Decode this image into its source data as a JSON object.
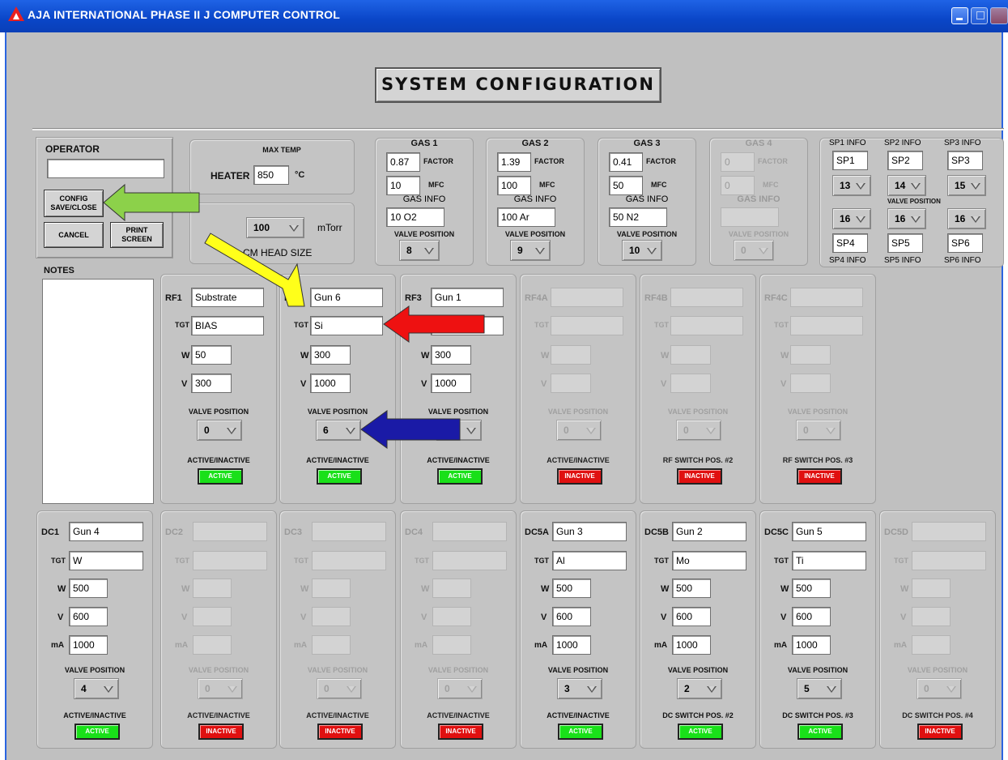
{
  "window": {
    "title": "AJA INTERNATIONAL PHASE II J COMPUTER CONTROL"
  },
  "header": {
    "title": "SYSTEM CONFIGURATION"
  },
  "operator": {
    "label": "OPERATOR",
    "value": "",
    "config_button": "CONFIG SAVE/CLOSE",
    "cancel_button": "CANCEL",
    "print_button": "PRINT SCREEN"
  },
  "notes": {
    "label": "NOTES",
    "value": ""
  },
  "heater": {
    "max_label": "MAX TEMP",
    "label": "HEATER",
    "value": "850",
    "unit": "°C"
  },
  "cm_head": {
    "value": "100",
    "unit": "mTorr",
    "label": "CM HEAD SIZE"
  },
  "gas": [
    {
      "name": "GAS 1",
      "factor": "0.87",
      "mfc": "10",
      "info": "10 O2",
      "valve": "8",
      "enabled": true
    },
    {
      "name": "GAS 2",
      "factor": "1.39",
      "mfc": "100",
      "info": "100 Ar",
      "valve": "9",
      "enabled": true
    },
    {
      "name": "GAS 3",
      "factor": "0.41",
      "mfc": "50",
      "info": "50 N2",
      "valve": "10",
      "enabled": true
    },
    {
      "name": "GAS 4",
      "factor": "0",
      "mfc": "0",
      "info": "",
      "valve": "0",
      "enabled": false
    }
  ],
  "gas_labels": {
    "factor": "FACTOR",
    "mfc": "MFC",
    "info": "GAS INFO",
    "valve": "VALVE POSITION"
  },
  "sp": {
    "top_labels": [
      "SP1 INFO",
      "SP2 INFO",
      "SP3 INFO"
    ],
    "top_values": [
      "SP1",
      "SP2",
      "SP3"
    ],
    "top_valves": [
      "13",
      "14",
      "15"
    ],
    "valve_label": "VALVE POSITION",
    "bottom_valves": [
      "16",
      "16",
      "16"
    ],
    "bottom_values": [
      "SP4",
      "SP5",
      "SP6"
    ],
    "bottom_labels": [
      "SP4 INFO",
      "SP5 INFO",
      "SP6 INFO"
    ]
  },
  "common": {
    "tgt": "TGT",
    "w": "W",
    "v": "V",
    "ma": "mA",
    "valve": "VALVE POSITION"
  },
  "rf": [
    {
      "name": "RF1",
      "gun": "Substrate",
      "tgt": "BIAS",
      "w": "50",
      "v": "300",
      "valve": "0",
      "status_label": "ACTIVE/INACTIVE",
      "status": "ACTIVE",
      "enabled": true
    },
    {
      "name": "RF2",
      "gun": "Gun 6",
      "tgt": "Si",
      "w": "300",
      "v": "1000",
      "valve": "6",
      "status_label": "ACTIVE/INACTIVE",
      "status": "ACTIVE",
      "enabled": true
    },
    {
      "name": "RF3",
      "gun": "Gun 1",
      "tgt": "",
      "w": "300",
      "v": "1000",
      "valve": "",
      "status_label": "ACTIVE/INACTIVE",
      "status": "ACTIVE",
      "enabled": true
    },
    {
      "name": "RF4A",
      "gun": "",
      "tgt": "",
      "w": "",
      "v": "",
      "valve": "0",
      "status_label": "ACTIVE/INACTIVE",
      "status": "INACTIVE",
      "enabled": false
    },
    {
      "name": "RF4B",
      "gun": "",
      "tgt": "",
      "w": "",
      "v": "",
      "valve": "0",
      "status_label": "RF SWITCH POS. #2",
      "status": "INACTIVE",
      "enabled": false
    },
    {
      "name": "RF4C",
      "gun": "",
      "tgt": "",
      "w": "",
      "v": "",
      "valve": "0",
      "status_label": "RF SWITCH POS. #3",
      "status": "INACTIVE",
      "enabled": false
    }
  ],
  "dc": [
    {
      "name": "DC1",
      "gun": "Gun 4",
      "tgt": "W",
      "w": "500",
      "v": "600",
      "ma": "1000",
      "valve": "4",
      "status_label": "ACTIVE/INACTIVE",
      "status": "ACTIVE",
      "enabled": true
    },
    {
      "name": "DC2",
      "gun": "",
      "tgt": "",
      "w": "",
      "v": "",
      "ma": "",
      "valve": "0",
      "status_label": "ACTIVE/INACTIVE",
      "status": "INACTIVE",
      "enabled": false
    },
    {
      "name": "DC3",
      "gun": "",
      "tgt": "",
      "w": "",
      "v": "",
      "ma": "",
      "valve": "0",
      "status_label": "ACTIVE/INACTIVE",
      "status": "INACTIVE",
      "enabled": false
    },
    {
      "name": "DC4",
      "gun": "",
      "tgt": "",
      "w": "",
      "v": "",
      "ma": "",
      "valve": "0",
      "status_label": "ACTIVE/INACTIVE",
      "status": "INACTIVE",
      "enabled": false
    },
    {
      "name": "DC5A",
      "gun": "Gun 3",
      "tgt": "Al",
      "w": "500",
      "v": "600",
      "ma": "1000",
      "valve": "3",
      "status_label": "ACTIVE/INACTIVE",
      "status": "ACTIVE",
      "enabled": true
    },
    {
      "name": "DC5B",
      "gun": "Gun 2",
      "tgt": "Mo",
      "w": "500",
      "v": "600",
      "ma": "1000",
      "valve": "2",
      "status_label": "DC SWITCH POS. #2",
      "status": "ACTIVE",
      "enabled": true
    },
    {
      "name": "DC5C",
      "gun": "Gun 5",
      "tgt": "Ti",
      "w": "500",
      "v": "600",
      "ma": "1000",
      "valve": "5",
      "status_label": "DC SWITCH POS. #3",
      "status": "ACTIVE",
      "enabled": true
    },
    {
      "name": "DC5D",
      "gun": "",
      "tgt": "",
      "w": "",
      "v": "",
      "ma": "",
      "valve": "0",
      "status_label": "DC SWITCH POS. #4",
      "status": "INACTIVE",
      "enabled": false
    }
  ],
  "colors": {
    "active": "#19e019",
    "inactive": "#e01010",
    "arrow_green": "#8cd14a",
    "arrow_yellow": "#ffff1a",
    "arrow_red": "#ee1111",
    "arrow_blue": "#1a1aa6"
  }
}
